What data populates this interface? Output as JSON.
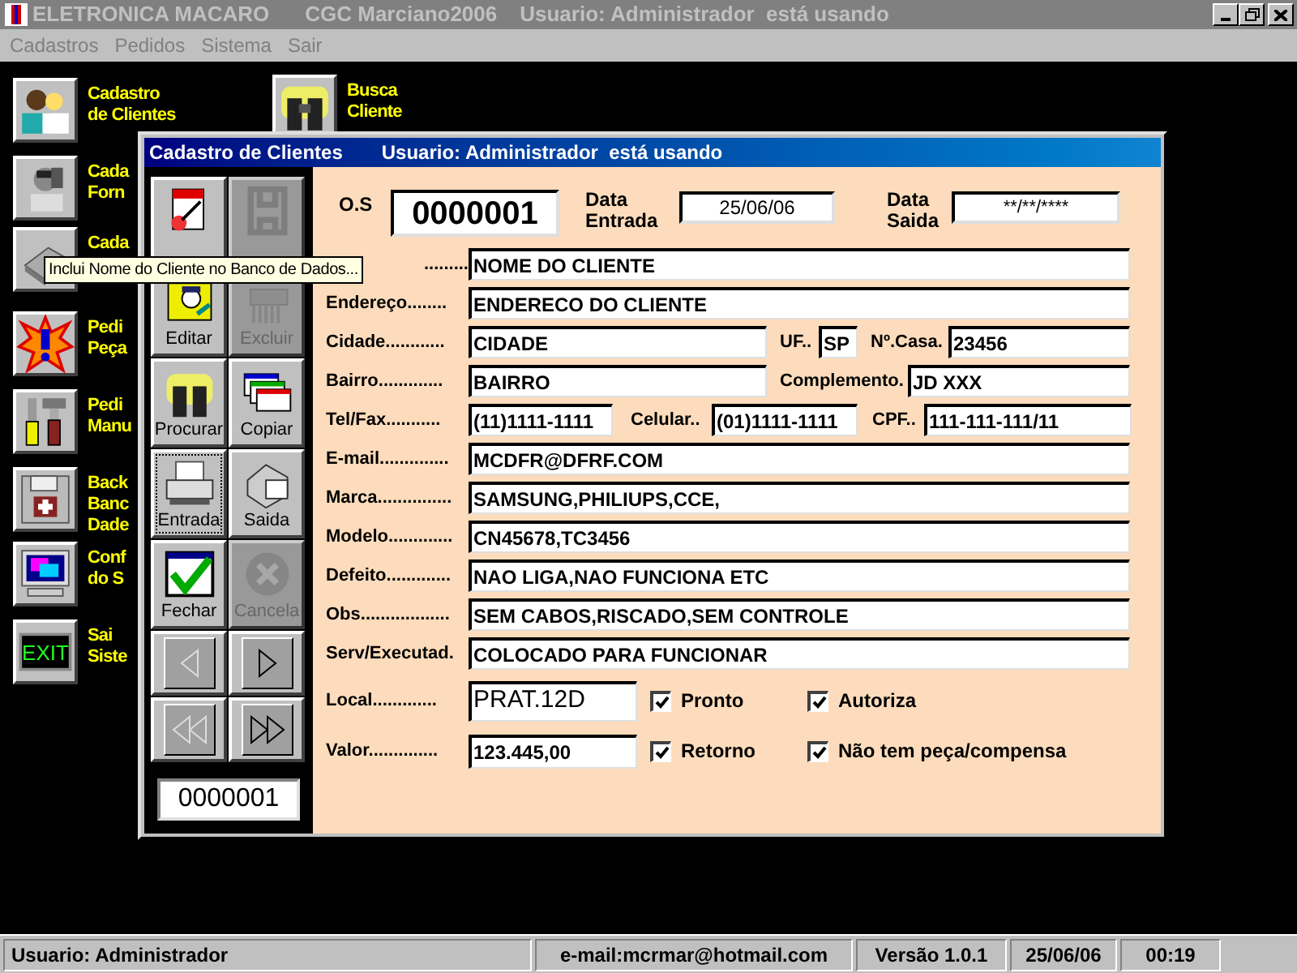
{
  "window": {
    "title": "ELETRONICA MACARO",
    "company": "CGC Marciano2006",
    "user": "Usuario: Administrador  está usando"
  },
  "menu": [
    "Cadastros",
    "Pedidos",
    "Sistema",
    "Sair"
  ],
  "shortcuts": [
    {
      "lines": [
        "Cadastro",
        "de Clientes"
      ]
    },
    {
      "lines": [
        "Cada",
        "Forn"
      ]
    },
    {
      "lines": [
        "Cada"
      ]
    },
    {
      "lines": [
        "Pedi",
        "Peça"
      ]
    },
    {
      "lines": [
        "Pedi",
        "Manu"
      ]
    },
    {
      "lines": [
        "Back",
        "Banc",
        "Dade"
      ]
    },
    {
      "lines": [
        "Conf",
        "do S"
      ]
    },
    {
      "lines": [
        "Sai",
        "Siste"
      ],
      "sign": "EXIT"
    },
    {
      "lines": [
        "Busca",
        "Cliente"
      ]
    }
  ],
  "dialog": {
    "title": "Cadastro de Clientes",
    "user": "Usuario: Administrador  está usando",
    "toolbar": [
      {
        "disabled": false,
        "focused": false
      },
      {
        "disabled": true,
        "focused": false
      },
      {
        "label": "Editar",
        "disabled": false,
        "focused": false
      },
      {
        "label": "Excluir",
        "disabled": true,
        "focused": false
      },
      {
        "label": "Procurar",
        "disabled": false,
        "focused": false
      },
      {
        "label": "Copiar",
        "disabled": false,
        "focused": false
      },
      {
        "label": "Entrada",
        "disabled": false,
        "focused": true
      },
      {
        "label": "Saida",
        "disabled": false,
        "focused": false
      },
      {
        "label": "Fechar",
        "disabled": false,
        "focused": false
      },
      {
        "label": "Cancela",
        "disabled": true,
        "focused": false
      }
    ],
    "counter": "0000001",
    "os": {
      "label": "O.S",
      "value": "0000001"
    },
    "date_in": {
      "label": "Data Entrada",
      "value": "25/06/06"
    },
    "date_out": {
      "label": "Data Saida",
      "value": "**/**/****"
    },
    "rows": [
      [
        {
          "label": ".........",
          "value": "NOME DO CLIENTE"
        }
      ],
      [
        {
          "label": "Endereço........",
          "value": "ENDERECO DO CLIENTE"
        }
      ],
      [
        {
          "label": "Cidade............",
          "value": "CIDADE"
        },
        {
          "label": "UF..",
          "value": "SP"
        },
        {
          "label": "Nº.Casa.",
          "value": "23456"
        }
      ],
      [
        {
          "label": "Bairro.............",
          "value": "BAIRRO"
        },
        {
          "label": "Complemento.",
          "value": "JD XXX"
        }
      ],
      [
        {
          "label": "Tel/Fax...........",
          "value": "(11)1111-1111"
        },
        {
          "label": "Celular..",
          "value": "(01)1111-1111"
        },
        {
          "label": "CPF..",
          "value": "111-111-111/11"
        }
      ],
      [
        {
          "label": "E-mail..............",
          "value": "MCDFR@DFRF.COM"
        }
      ],
      [
        {
          "label": "Marca...............",
          "value": "SAMSUNG,PHILIUPS,CCE,"
        }
      ],
      [
        {
          "label": "Modelo.............",
          "value": "CN45678,TC3456"
        }
      ],
      [
        {
          "label": "Defeito.............",
          "value": "NAO LIGA,NAO FUNCIONA ETC"
        }
      ],
      [
        {
          "label": "Obs..................",
          "value": "SEM CABOS,RISCADO,SEM CONTROLE"
        }
      ],
      [
        {
          "label": "Serv/Executad.",
          "value": "COLOCADO PARA FUNCIONAR"
        }
      ]
    ],
    "check_rows": [
      {
        "label": "Local.............",
        "value": "PRAT.12D",
        "checks": [
          {
            "label": "Pronto",
            "checked": true
          },
          {
            "label": "Autoriza",
            "checked": true
          }
        ]
      },
      {
        "label": "Valor..............",
        "value": "123.445,00",
        "checks": [
          {
            "label": "Retorno",
            "checked": true
          },
          {
            "label": "Não tem peça/compensa",
            "checked": true
          }
        ]
      }
    ]
  },
  "tooltip": "Inclui Nome do Cliente no Banco de Dados...",
  "status_bar": [
    "Usuario: Administrador",
    "e-mail:mcrmar@hotmail.com",
    "Versão 1.0.1",
    "25/06/06",
    "00:19"
  ]
}
